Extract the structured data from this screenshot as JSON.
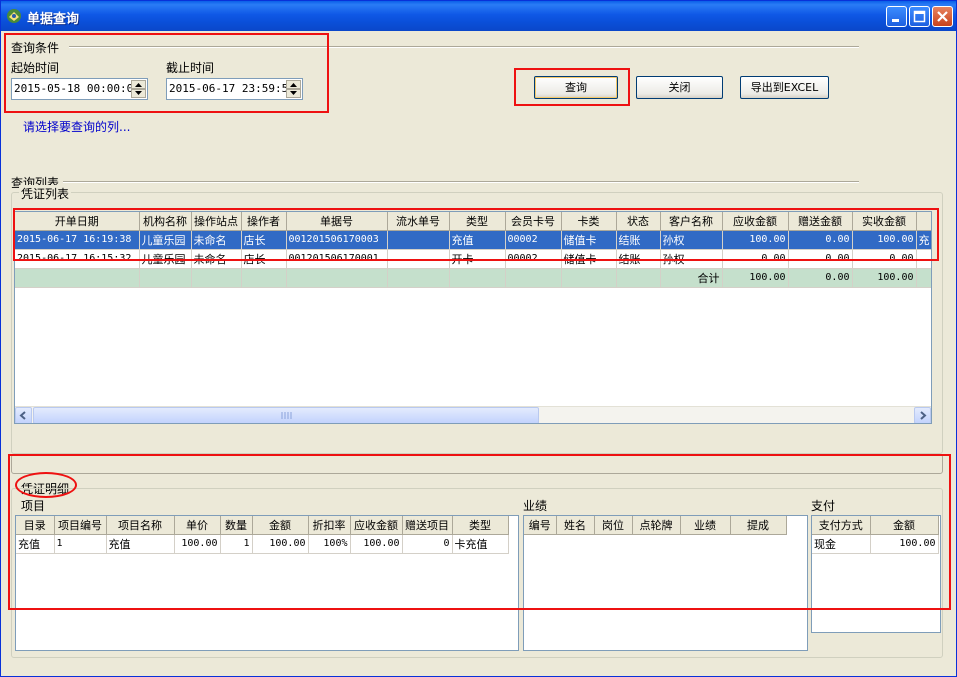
{
  "window": {
    "title": "单据查询"
  },
  "query": {
    "section_label": "查询条件",
    "start_label": "起始时间",
    "start_value": "2015-05-18 00:00:00",
    "end_label": "截止时间",
    "end_value": "2015-06-17 23:59:59",
    "hint": "请选择要查询的列..."
  },
  "buttons": {
    "query": "查询",
    "close": "关闭",
    "export": "导出到EXCEL"
  },
  "list": {
    "section_label": "查询列表",
    "group_label": "凭证列表",
    "columns": [
      "开单日期",
      "机构名称",
      "操作站点",
      "操作者",
      "单据号",
      "流水单号",
      "类型",
      "会员卡号",
      "卡类",
      "状态",
      "客户名称",
      "应收金额",
      "赠送金额",
      "实收金额",
      ""
    ],
    "rows": [
      [
        "2015-06-17 16:19:38",
        "儿童乐园",
        "未命名",
        "店长",
        "001201506170003",
        "",
        "充值",
        "00002",
        "储值卡",
        "结账",
        "孙权",
        "100.00",
        "0.00",
        "100.00",
        "充"
      ],
      [
        "2015-06-17 16:15:32",
        "儿童乐园",
        "未命名",
        "店长",
        "001201506170001",
        "",
        "开卡",
        "00002",
        "储值卡",
        "结账",
        "孙权",
        "0.00",
        "0.00",
        "0.00",
        ""
      ]
    ],
    "total_row": [
      "",
      "",
      "",
      "",
      "",
      "",
      "",
      "",
      "",
      "",
      "合计",
      "100.00",
      "0.00",
      "100.00",
      ""
    ]
  },
  "detail": {
    "section_label": "凭证明细",
    "items": {
      "label": "项目",
      "columns": [
        "目录",
        "项目编号",
        "项目名称",
        "单价",
        "数量",
        "金额",
        "折扣率",
        "应收金额",
        "赠送项目",
        "类型"
      ],
      "rows": [
        [
          "充值",
          "1",
          "充值",
          "100.00",
          "1",
          "100.00",
          "100%",
          "100.00",
          "0",
          "卡充值"
        ]
      ]
    },
    "performance": {
      "label": "业绩",
      "columns": [
        "编号",
        "姓名",
        "岗位",
        "点轮牌",
        "业绩",
        "提成"
      ]
    },
    "payment": {
      "label": "支付",
      "columns": [
        "支付方式",
        "金额"
      ],
      "rows": [
        [
          "现金",
          "100.00"
        ]
      ]
    }
  },
  "colors": {
    "title_bar": "#0a4fd9",
    "selected_row": "#316ac5",
    "total_row": "#c5e0cc",
    "highlight": "#ee1111"
  }
}
